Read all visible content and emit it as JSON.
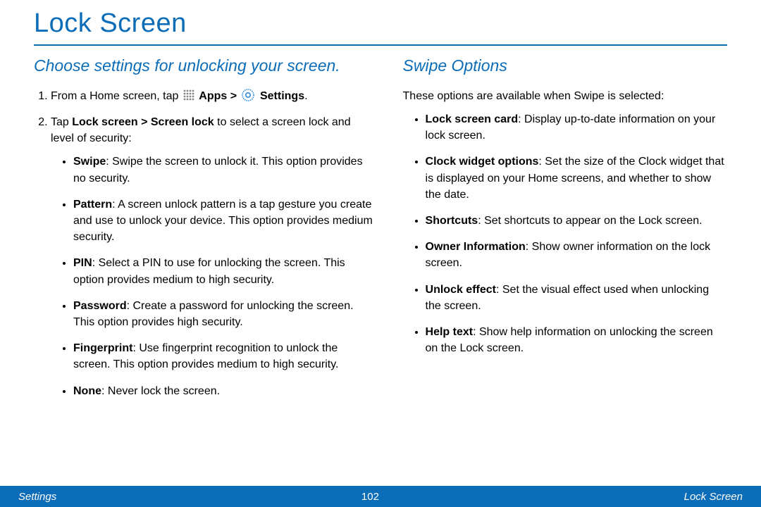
{
  "title": "Lock Screen",
  "left": {
    "subhead": "Choose settings for unlocking your screen.",
    "step1_pre": "From a Home screen, tap ",
    "step1_apps": "Apps > ",
    "step1_settings": "Settings",
    "step1_post": ".",
    "step2_pre": "Tap ",
    "step2_path": "Lock screen > Screen lock",
    "step2_post": " to select a screen lock and level of security:",
    "opts": {
      "swipe_b": "Swipe",
      "swipe_t": ": Swipe the screen to unlock it. This option provides no security.",
      "pattern_b": "Pattern",
      "pattern_t": ": A screen unlock pattern is a tap gesture you create and use to unlock your device. This option provides medium security.",
      "pin_b": "PIN",
      "pin_t": ": Select a PIN to use for unlocking the screen. This option provides medium to high security.",
      "password_b": "Password",
      "password_t": ": Create a password for unlocking the screen. This option provides high security.",
      "finger_b": "Fingerprint",
      "finger_t": ": Use fingerprint recognition to unlock the screen. This option provides medium to high security.",
      "none_b": "None",
      "none_t": ": Never lock the screen."
    }
  },
  "right": {
    "subhead": "Swipe Options",
    "intro": "These options are available when Swipe is selected:",
    "opts": {
      "card_b": "Lock screen card",
      "card_t": ": Display up-to-date information on your lock screen.",
      "clock_b": "Clock widget options",
      "clock_t": ": Set the size of the Clock widget that is displayed on your Home screens, and whether to show the date.",
      "short_b": "Shortcuts",
      "short_t": ": Set shortcuts to appear on the Lock screen.",
      "owner_b": "Owner Information",
      "owner_t": ": Show owner information on the lock screen.",
      "effect_b": "Unlock effect",
      "effect_t": ": Set the visual effect used when unlocking the screen.",
      "help_b": "Help text",
      "help_t": ": Show help information on unlocking the screen on the Lock screen."
    }
  },
  "footer": {
    "left": "Settings",
    "center": "102",
    "right": "Lock Screen"
  }
}
